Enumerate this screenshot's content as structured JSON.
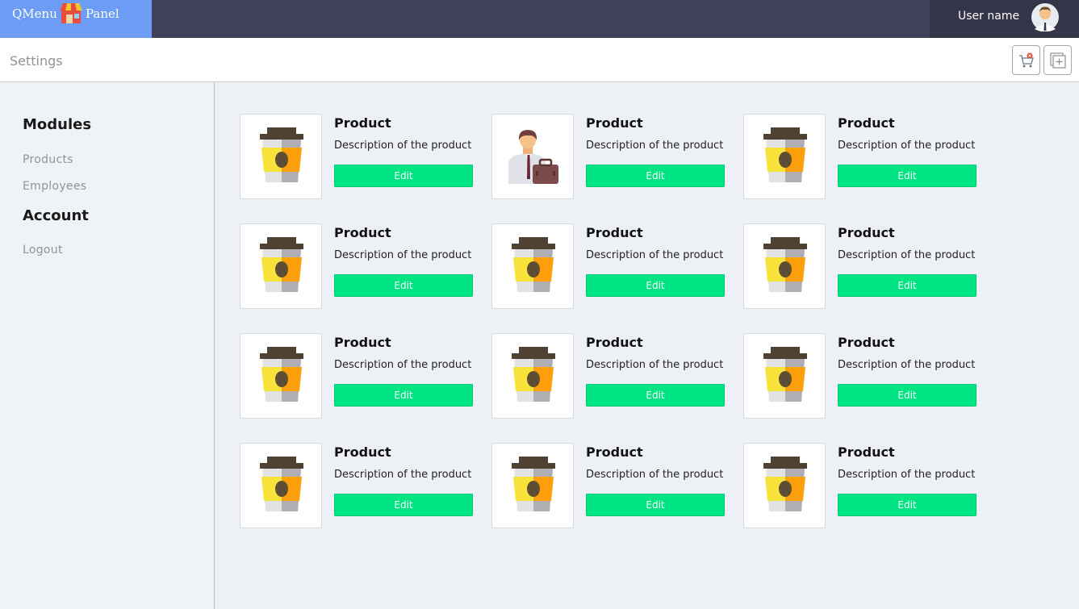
{
  "brand": {
    "word1": "QMenu",
    "word2": "Panel"
  },
  "user": {
    "name": "User name"
  },
  "page": {
    "title": "Settings"
  },
  "sidebar": {
    "sections": [
      {
        "heading": "Modules",
        "links": [
          "Products",
          "Employees"
        ]
      },
      {
        "heading": "Account",
        "links": [
          "Logout"
        ]
      }
    ]
  },
  "colors": {
    "topbar": "#41415a",
    "brand": "#6c9cf3",
    "edit_button": "#00e584"
  },
  "icons": {
    "toolbar": [
      "cart-remove-icon",
      "add-window-icon"
    ]
  },
  "products": [
    {
      "title": "Product",
      "description": "Description of the product",
      "button": "Edit",
      "icon": "coffee-cup-icon"
    },
    {
      "title": "Product",
      "description": "Description of the product",
      "button": "Edit",
      "icon": "businessman-icon"
    },
    {
      "title": "Product",
      "description": "Description of the product",
      "button": "Edit",
      "icon": "coffee-cup-icon"
    },
    {
      "title": "Product",
      "description": "Description of the product",
      "button": "Edit",
      "icon": "coffee-cup-icon"
    },
    {
      "title": "Product",
      "description": "Description of the product",
      "button": "Edit",
      "icon": "coffee-cup-icon"
    },
    {
      "title": "Product",
      "description": "Description of the product",
      "button": "Edit",
      "icon": "coffee-cup-icon"
    },
    {
      "title": "Product",
      "description": "Description of the product",
      "button": "Edit",
      "icon": "coffee-cup-icon"
    },
    {
      "title": "Product",
      "description": "Description of the product",
      "button": "Edit",
      "icon": "coffee-cup-icon"
    },
    {
      "title": "Product",
      "description": "Description of the product",
      "button": "Edit",
      "icon": "coffee-cup-icon"
    },
    {
      "title": "Product",
      "description": "Description of the product",
      "button": "Edit",
      "icon": "coffee-cup-icon"
    },
    {
      "title": "Product",
      "description": "Description of the product",
      "button": "Edit",
      "icon": "coffee-cup-icon"
    },
    {
      "title": "Product",
      "description": "Description of the product",
      "button": "Edit",
      "icon": "coffee-cup-icon"
    }
  ]
}
